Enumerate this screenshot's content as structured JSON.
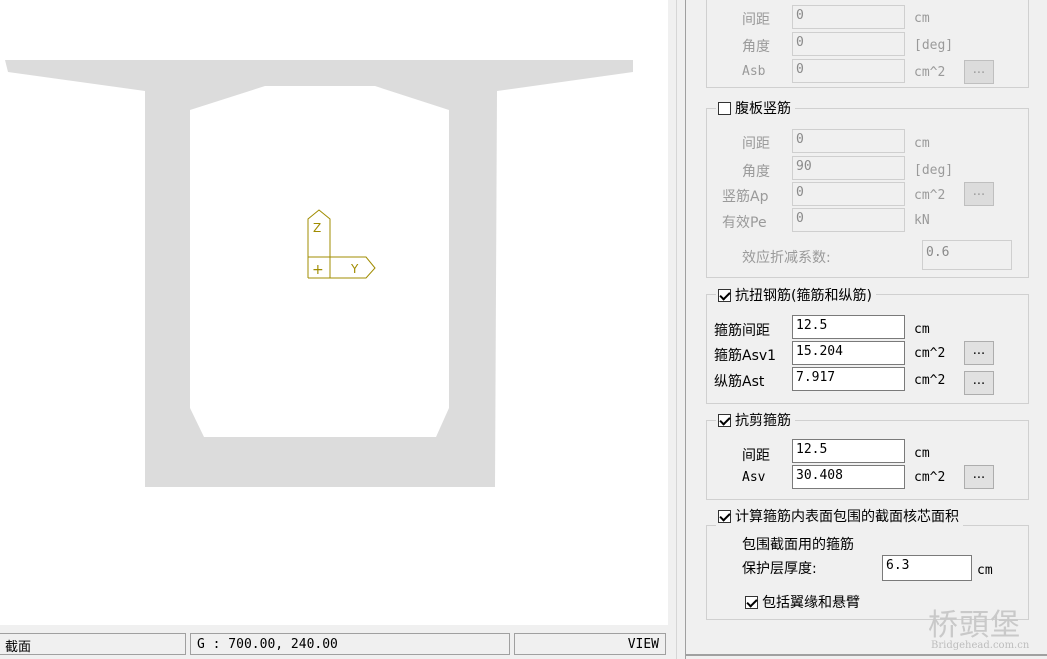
{
  "status_bar": {
    "left": "截面",
    "middle": "G : 700.00, 240.00",
    "right": "VIEW"
  },
  "axes": {
    "z": "Z",
    "y": "Y",
    "origin": "+"
  },
  "colors": {
    "section_fill": "#dcdcdc",
    "axis_color": "#a08c00"
  },
  "top_partial": {
    "rows": [
      {
        "label": "间距",
        "value": "0",
        "unit": "cm"
      },
      {
        "label": "角度",
        "value": "0",
        "unit": "[deg]"
      },
      {
        "label": "Asb",
        "value": "0",
        "unit": "cm^2",
        "button": "..."
      }
    ]
  },
  "web_vertical": {
    "title": "腹板竖筋",
    "checked": false,
    "rows": [
      {
        "label": "间距",
        "value": "0",
        "unit": "cm"
      },
      {
        "label": "角度",
        "value": "90",
        "unit": "[deg]"
      },
      {
        "label": "竖筋Ap",
        "value": "0",
        "unit": "cm^2",
        "button": "..."
      },
      {
        "label": "有效Pe",
        "value": "0",
        "unit": "kN"
      }
    ],
    "reduction_label": "效应折减系数:",
    "reduction_value": "0.6"
  },
  "torsion": {
    "title": "抗扭钢筋(箍筋和纵筋)",
    "checked": true,
    "rows": [
      {
        "label": "箍筋间距",
        "value": "12.5",
        "unit": "cm"
      },
      {
        "label": "箍筋Asv1",
        "value": "15.204",
        "unit": "cm^2",
        "button": "..."
      },
      {
        "label": "纵筋Ast",
        "value": "7.917",
        "unit": "cm^2",
        "button": "..."
      }
    ]
  },
  "shear": {
    "title": "抗剪箍筋",
    "checked": true,
    "rows": [
      {
        "label": "间距",
        "value": "12.5",
        "unit": "cm"
      },
      {
        "label": "Asv",
        "value": "30.408",
        "unit": "cm^2",
        "button": "..."
      }
    ]
  },
  "core": {
    "title": "计算箍筋内表面包围的截面核芯面积",
    "checked": true,
    "sub_label": "包围截面用的箍筋",
    "cover_label": "保护层厚度:",
    "cover_value": "6.3",
    "cover_unit": "cm",
    "include_label": "包括翼缘和悬臂",
    "include_checked": true
  },
  "watermark": {
    "big": "桥頭堡",
    "small": "Bridgehead.com.cn"
  }
}
